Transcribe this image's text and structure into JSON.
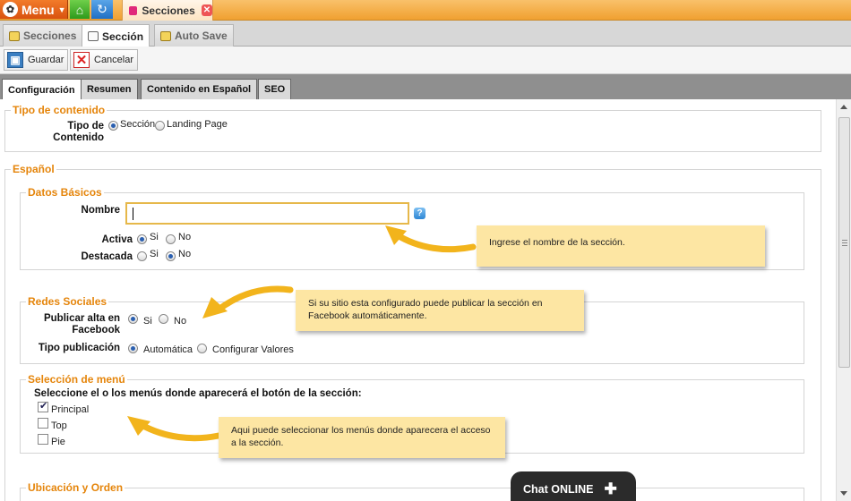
{
  "topbar": {
    "menu_label": "Menu",
    "document_tab": "Secciones"
  },
  "subtabs": [
    {
      "label": "Secciones"
    },
    {
      "label": "Sección"
    },
    {
      "label": "Auto Save"
    }
  ],
  "toolbar": {
    "save_label": "Guardar",
    "cancel_label": "Cancelar"
  },
  "form_tabs": [
    {
      "label": "Configuración"
    },
    {
      "label": "Resumen"
    },
    {
      "label": "Contenido en Español"
    },
    {
      "label": "SEO"
    }
  ],
  "tipo_contenido": {
    "legend": "Tipo de contenido",
    "label": "Tipo de Contenido",
    "options": [
      "Sección",
      "Landing Page"
    ],
    "selected": "Sección"
  },
  "espanol": {
    "legend": "Español"
  },
  "datos_basicos": {
    "legend": "Datos Básicos",
    "nombre_label": "Nombre",
    "nombre_value": "",
    "activa_label": "Activa",
    "activa_options": [
      "Si",
      "No"
    ],
    "activa_selected": "Si",
    "destacada_label": "Destacada",
    "destacada_options": [
      "Si",
      "No"
    ],
    "destacada_selected": "No"
  },
  "redes_sociales": {
    "legend": "Redes Sociales",
    "publicar_label": "Publicar alta en Facebook",
    "publicar_options": [
      "Si",
      "No"
    ],
    "publicar_selected": "Si",
    "tipo_label": "Tipo publicación",
    "tipo_options": [
      "Automática",
      "Configurar Valores"
    ],
    "tipo_selected": "Automática"
  },
  "seleccion_menu": {
    "legend": "Selección de menú",
    "instruction": "Seleccione el o los menús donde aparecerá el botón de la sección:",
    "items": [
      {
        "label": "Principal",
        "checked": true
      },
      {
        "label": "Top",
        "checked": false
      },
      {
        "label": "Pie",
        "checked": false
      }
    ]
  },
  "ubicacion": {
    "legend": "Ubicación y Orden"
  },
  "tooltips": {
    "nombre": "Ingrese el nombre de la sección.",
    "redes": "Si su sitio esta configurado puede publicar la sección en Facebook automáticamente.",
    "menu": "Aqui puede seleccionar los menús donde aparecera el acceso a la sección."
  },
  "chat": {
    "label": "Chat ONLINE"
  },
  "colors": {
    "accent": "#e5850b",
    "tooltip_bg": "#fde6a3",
    "arrow": "#f2b41c"
  }
}
